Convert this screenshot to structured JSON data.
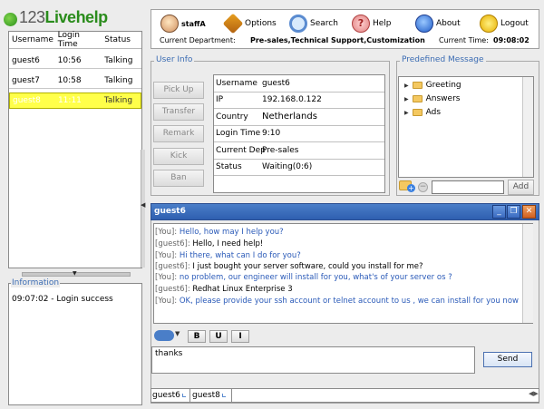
{
  "app": {
    "logo_prefix": "123",
    "logo_suffix": "Livehelp"
  },
  "guests": {
    "headers": [
      "Username",
      "Login Time",
      "Status"
    ],
    "rows": [
      {
        "username": "guest6",
        "login_time": "10:56",
        "status": "Talking"
      },
      {
        "username": "guest7",
        "login_time": "10:58",
        "status": "Talking"
      },
      {
        "username": "guest8",
        "login_time": "11:11",
        "status": "Talking"
      }
    ]
  },
  "information": {
    "title": "Information",
    "log": "09:07:02 - Login success"
  },
  "toolbar": {
    "staff": "staffA",
    "options": "Options",
    "search": "Search",
    "help": "Help",
    "about": "About",
    "logout": "Logout",
    "dept_label": "Current Department:",
    "dept_value": "Pre-sales,Technical Support,Customization Requ",
    "time_label": "Current Time:",
    "time_value": "09:08:02"
  },
  "user_info": {
    "title": "User Info",
    "buttons": {
      "pickup": "Pick Up",
      "transfer": "Transfer",
      "remark": "Remark",
      "kick": "Kick",
      "ban": "Ban"
    },
    "fields": [
      {
        "key": "Username",
        "value": "guest6"
      },
      {
        "key": "IP",
        "value": "192.168.0.122"
      },
      {
        "key": "Country",
        "value": "Netherlands"
      },
      {
        "key": "Login Time",
        "value": "9:10"
      },
      {
        "key": "Current Dep",
        "value": "Pre-sales"
      },
      {
        "key": "Status",
        "value": "Waiting(0:6)"
      }
    ]
  },
  "predefined": {
    "title": "Predefined Message",
    "items": [
      "Greeting",
      "Answers",
      "Ads"
    ],
    "add_label": "Add"
  },
  "chat": {
    "title": "guest6",
    "messages": [
      {
        "who": "[You]:",
        "text": "Hello, how may I help you?"
      },
      {
        "who": "[guest6]:",
        "text": "Hello, I need help!"
      },
      {
        "who": "[You]:",
        "text": "Hi there, what can I do for you?"
      },
      {
        "who": "[guest6]:",
        "text": "I just bought your server software, could you install for me?"
      },
      {
        "who": "[You]:",
        "text": "no problem, our engineer will install for you, what's of your server os ?"
      },
      {
        "who": "[guest6]:",
        "text": "Redhat Linux Enterprise 3"
      },
      {
        "who": "[You]:",
        "text": "OK, please provide your ssh account or telnet account to us , we can install for you now"
      }
    ],
    "format": {
      "bold": "B",
      "underline": "U",
      "italic": "I"
    },
    "compose_value": "thanks",
    "send_label": "Send"
  },
  "session_tabs": [
    "guest6",
    "guest8"
  ]
}
